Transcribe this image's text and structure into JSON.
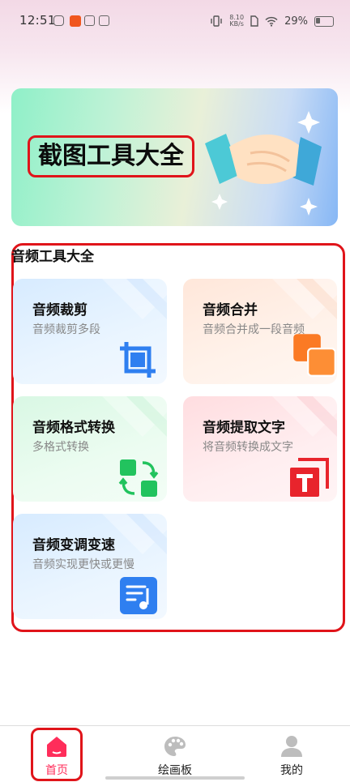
{
  "status_bar": {
    "time": "12:51",
    "speed_top": "8.10",
    "speed_unit": "KB/s",
    "battery": "29%"
  },
  "banner": {
    "title": "截图工具大全"
  },
  "section": {
    "title": "音频工具大全",
    "tools": [
      {
        "title": "音频裁剪",
        "subtitle": "音频裁剪多段",
        "icon": "crop-icon"
      },
      {
        "title": "音频合并",
        "subtitle": "音频合并成一段音频",
        "icon": "merge-icon"
      },
      {
        "title": "音频格式转换",
        "subtitle": "多格式转换",
        "icon": "convert-icon"
      },
      {
        "title": "音频提取文字",
        "subtitle": "将音频转换成文字",
        "icon": "text-extract-icon"
      },
      {
        "title": "音频变调变速",
        "subtitle": "音频实现更快或更慢",
        "icon": "music-list-icon"
      }
    ]
  },
  "bottom_nav": {
    "items": [
      {
        "label": "首页",
        "icon": "home-icon",
        "active": true
      },
      {
        "label": "绘画板",
        "icon": "palette-icon",
        "active": false
      },
      {
        "label": "我的",
        "icon": "user-icon",
        "active": false
      }
    ]
  },
  "colors": {
    "accent": "#ff2d5a",
    "highlight_border": "#e0141a"
  }
}
